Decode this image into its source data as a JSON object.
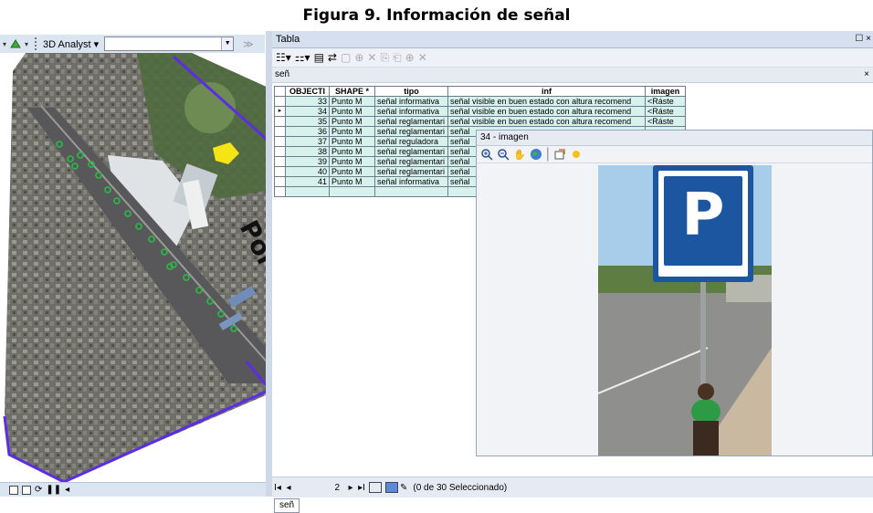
{
  "caption": "Figura 9. Información de señal",
  "left_toolbar": {
    "analyst_label": "3D Analyst",
    "analyst_icon": "chevron-down-icon",
    "layer_value": ""
  },
  "map": {
    "boundary_color": "#5b2ee6",
    "point_color": "#2fb14a",
    "highlight_color": "#f5e416",
    "partial_label": "Por"
  },
  "table_window": {
    "title": "Tabla",
    "tab_label": "señ",
    "columns": [
      "OBJECTI",
      "SHAPE *",
      "tipo",
      "inf",
      "imagen"
    ],
    "rows": [
      {
        "id": "33",
        "shape": "Punto M",
        "tipo": "señal informativa",
        "inf": "señal visible  en buen estado  con altura recomend",
        "imagen": "<Ráste",
        "current": false
      },
      {
        "id": "34",
        "shape": "Punto M",
        "tipo": "señal informativa",
        "inf": "señal visible  en buen estado  con altura recomend",
        "imagen": "<Ráste",
        "current": true
      },
      {
        "id": "35",
        "shape": "Punto M",
        "tipo": "señal  reglamentari",
        "inf": "señal  visible  en buen  estado  con altura recomend",
        "imagen": "<Ráste",
        "current": false
      },
      {
        "id": "36",
        "shape": "Punto M",
        "tipo": "señal reglamentari",
        "inf": "señal",
        "imagen": "",
        "current": false
      },
      {
        "id": "37",
        "shape": "Punto M",
        "tipo": "señal  reguladora",
        "inf": "señal",
        "imagen": "",
        "current": false
      },
      {
        "id": "38",
        "shape": "Punto M",
        "tipo": "señal  reglamentari",
        "inf": "señal",
        "imagen": "",
        "current": false
      },
      {
        "id": "39",
        "shape": "Punto M",
        "tipo": "señal reglamentari",
        "inf": "señal",
        "imagen": "",
        "current": false
      },
      {
        "id": "40",
        "shape": "Punto M",
        "tipo": "señal  reglamentari",
        "inf": "señal",
        "imagen": "",
        "current": false
      },
      {
        "id": "41",
        "shape": "Punto M",
        "tipo": "señal informativa",
        "inf": "señal",
        "imagen": "",
        "current": false
      }
    ],
    "status": {
      "record": "2",
      "selection": "(0 de 30 Seleccionado)"
    },
    "bottom_tab": "señ"
  },
  "popup": {
    "title": "34 - imagen",
    "tools": [
      "zoom-in-icon",
      "zoom-out-icon",
      "pan-hand-icon",
      "globe-icon",
      "export-icon",
      "brightness-icon"
    ],
    "sign_letter": "P"
  }
}
